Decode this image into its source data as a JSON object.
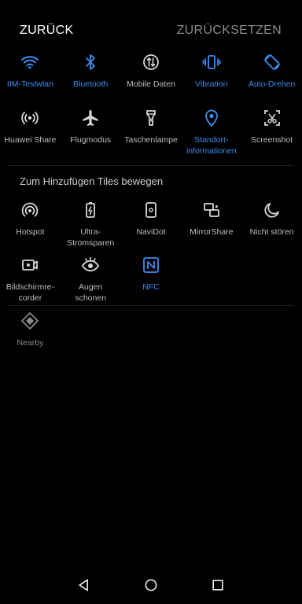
{
  "header": {
    "back_label": "ZURÜCK",
    "reset_label": "ZURÜCKSETZEN"
  },
  "active_tiles": [
    {
      "name": "tile-wifi",
      "icon": "wifi-icon",
      "label": "IIM-Testwlan",
      "enabled": true
    },
    {
      "name": "tile-bluetooth",
      "icon": "bluetooth-icon",
      "label": "Bluetooth",
      "enabled": true
    },
    {
      "name": "tile-mobile-data",
      "icon": "mobile-data-icon",
      "label": "Mobile Daten",
      "enabled": false
    },
    {
      "name": "tile-vibration",
      "icon": "vibration-icon",
      "label": "Vibration",
      "enabled": true
    },
    {
      "name": "tile-auto-rotate",
      "icon": "auto-rotate-icon",
      "label": "Auto-Drehen",
      "enabled": true
    },
    {
      "name": "tile-huawei-share",
      "icon": "huawei-share-icon",
      "label": "Huawei Share",
      "enabled": false
    },
    {
      "name": "tile-airplane-mode",
      "icon": "airplane-icon",
      "label": "Flugmodus",
      "enabled": false
    },
    {
      "name": "tile-flashlight",
      "icon": "flashlight-icon",
      "label": "Taschenlampe",
      "enabled": false
    },
    {
      "name": "tile-location",
      "icon": "location-icon",
      "label": "Standort-\ninformationen",
      "enabled": true
    },
    {
      "name": "tile-screenshot",
      "icon": "screenshot-icon",
      "label": "Screenshot",
      "enabled": false
    }
  ],
  "section_hint": "Zum Hinzufügen Tiles bewegen",
  "inactive_tiles": [
    {
      "name": "tile-hotspot",
      "icon": "hotspot-icon",
      "label": "Hotspot",
      "enabled": false
    },
    {
      "name": "tile-ultra-power",
      "icon": "battery-saver-icon",
      "label": "Ultra-\nStromsparen",
      "enabled": false
    },
    {
      "name": "tile-navidot",
      "icon": "navidot-icon",
      "label": "NaviDot",
      "enabled": false
    },
    {
      "name": "tile-mirrorshare",
      "icon": "mirrorshare-icon",
      "label": "MirrorShare",
      "enabled": false
    },
    {
      "name": "tile-do-not-disturb",
      "icon": "moon-icon",
      "label": "Nicht stören",
      "enabled": false
    },
    {
      "name": "tile-screen-recorder",
      "icon": "screen-recorder-icon",
      "label": "Bildschirmre-\ncorder",
      "enabled": false
    },
    {
      "name": "tile-eye-comfort",
      "icon": "eye-icon",
      "label": "Augen\nschonen",
      "enabled": false
    },
    {
      "name": "tile-nfc",
      "icon": "nfc-icon",
      "label": "NFC",
      "enabled": true
    }
  ],
  "extra_tiles": [
    {
      "name": "tile-nearby",
      "icon": "nearby-icon",
      "label": "Nearby",
      "enabled": false,
      "dimmed": true
    }
  ],
  "colors": {
    "background": "#000000",
    "accent": "#3b8bf0",
    "text": "#bdbdbd",
    "dimmed": "#8a8a8a"
  },
  "navbar": [
    {
      "name": "nav-back-button",
      "icon": "triangle-back-icon"
    },
    {
      "name": "nav-home-button",
      "icon": "circle-home-icon"
    },
    {
      "name": "nav-recents-button",
      "icon": "square-recents-icon"
    }
  ]
}
